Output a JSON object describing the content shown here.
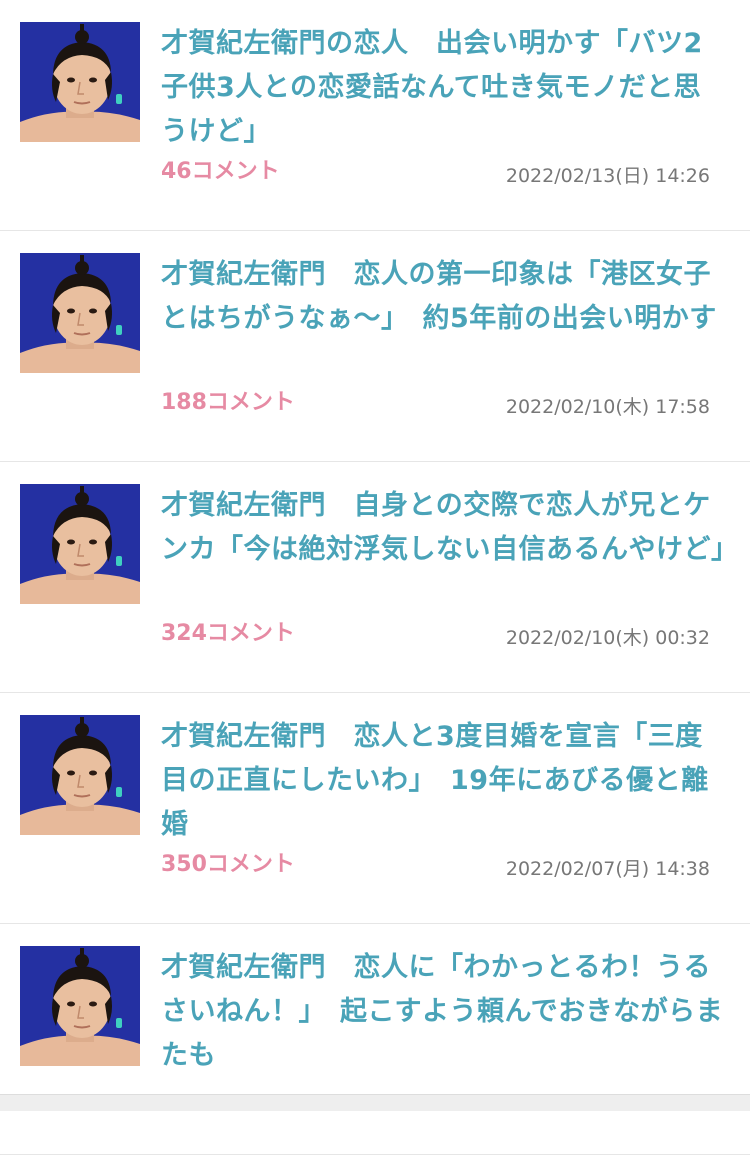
{
  "articles": [
    {
      "title": "才賀紀左衛門の恋人　出会い明かす「バツ2子供3人との恋愛話なんて吐き気モノだと思うけど」",
      "comments": "46コメント",
      "date": "2022/02/13(日) 14:26",
      "thumbnail": "wrestler-portrait"
    },
    {
      "title": "才賀紀左衛門　恋人の第一印象は「港区女子とはちがうなぁ〜」　約5年前の出会い明かす",
      "comments": "188コメント",
      "date": "2022/02/10(木) 17:58",
      "thumbnail": "wrestler-portrait"
    },
    {
      "title": "才賀紀左衛門　自身との交際で恋人が兄とケンカ「今は絶対浮気しない自信あるんやけど」",
      "comments": "324コメント",
      "date": "2022/02/10(木) 00:32",
      "thumbnail": "wrestler-portrait"
    },
    {
      "title": "才賀紀左衛門　恋人と3度目婚を宣言「三度目の正直にしたいわ」　19年にあびる優と離婚",
      "comments": "350コメント",
      "date": "2022/02/07(月) 14:38",
      "thumbnail": "wrestler-portrait"
    },
    {
      "title": "才賀紀左衛門　恋人に「わかっとるわ！うるさいねん！」　起こすよう頼んでおきながらまたも",
      "comments": "",
      "date": "",
      "thumbnail": "wrestler-portrait"
    }
  ]
}
